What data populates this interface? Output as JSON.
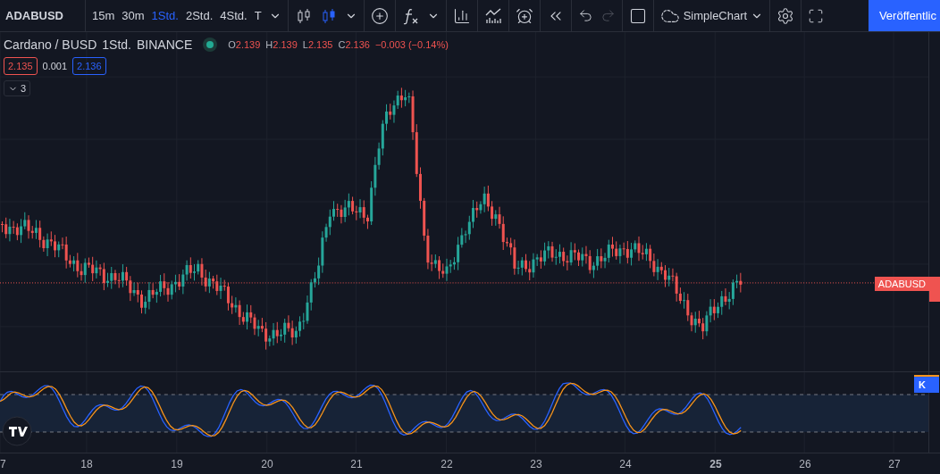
{
  "toolbar": {
    "symbol": "ADABUSD",
    "intervals": [
      {
        "label": "15m",
        "selected": false
      },
      {
        "label": "30m",
        "selected": false
      },
      {
        "label": "1Std.",
        "selected": true
      },
      {
        "label": "2Std.",
        "selected": false
      },
      {
        "label": "4Std.",
        "selected": false
      },
      {
        "label": "T",
        "selected": false
      }
    ],
    "chart_types": [
      {
        "kind": "hollow_candles",
        "selected": false
      },
      {
        "kind": "candles",
        "selected": true
      }
    ],
    "layout_name": "SimpleChart",
    "publish_button": "Veröffentlic"
  },
  "legend": {
    "symbol_name": "Cardano / BUSD",
    "interval": "1Std.",
    "exchange": "BINANCE",
    "ohlc": [
      {
        "label": "O",
        "value": "2.139"
      },
      {
        "label": "H",
        "value": "2.139"
      },
      {
        "label": "L",
        "value": "2.135"
      },
      {
        "label": "C",
        "value": "2.136"
      }
    ],
    "change": "−0.003 (−0.14%)",
    "bid": "2.135",
    "spread": "0.001",
    "ask": "2.136",
    "collapsed_count": "3"
  },
  "price_label": "ADABUSD",
  "oscillator_label": "K",
  "date_axis": [
    {
      "label": "7",
      "bold": false
    },
    {
      "label": "18",
      "bold": false
    },
    {
      "label": "19",
      "bold": false
    },
    {
      "label": "20",
      "bold": false
    },
    {
      "label": "21",
      "bold": false
    },
    {
      "label": "22",
      "bold": false
    },
    {
      "label": "23",
      "bold": false
    },
    {
      "label": "24",
      "bold": false
    },
    {
      "label": "25",
      "bold": true
    },
    {
      "label": "26",
      "bold": false
    },
    {
      "label": "27",
      "bold": false
    }
  ]
}
